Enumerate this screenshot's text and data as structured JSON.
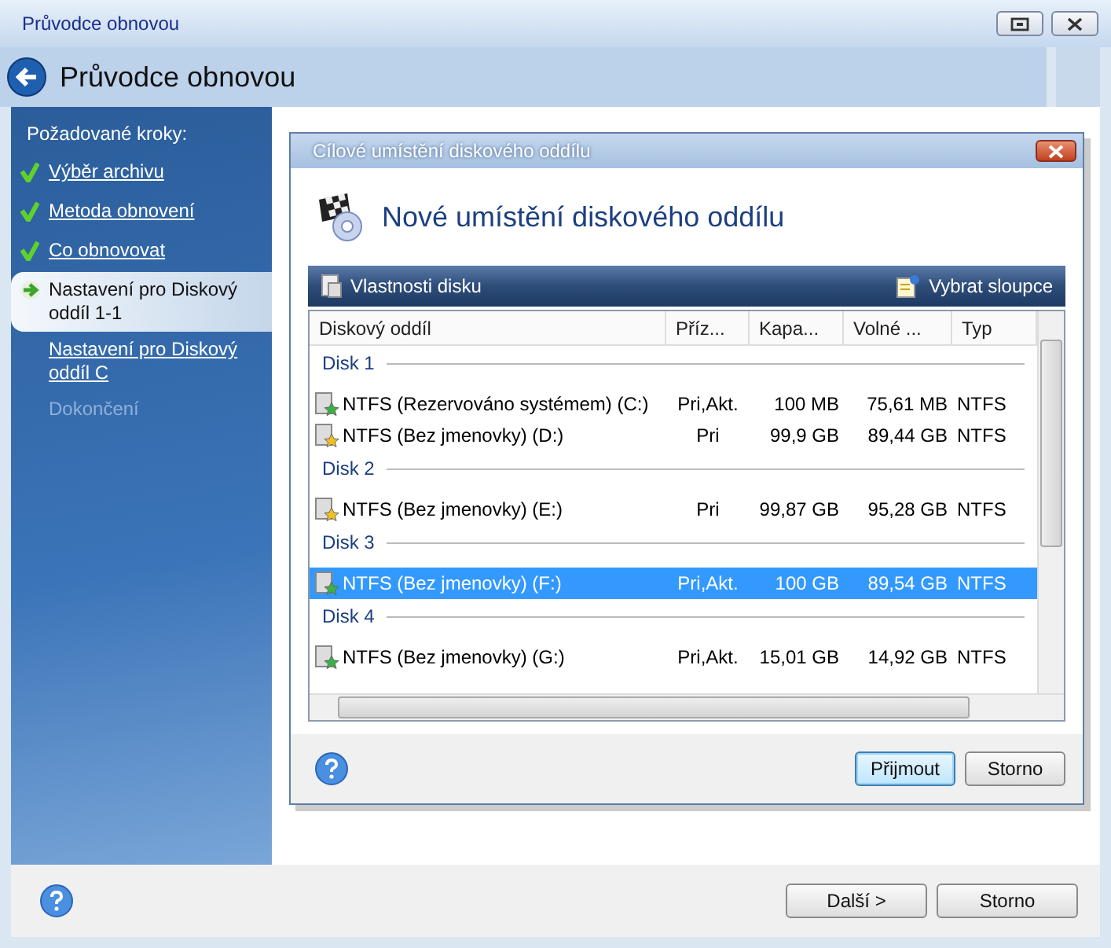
{
  "window": {
    "title": "Průvodce obnovou",
    "header": "Průvodce obnovou"
  },
  "sidebar": {
    "heading": "Požadované kroky:",
    "items": [
      {
        "label": "Výběr archivu",
        "kind": "done",
        "selected": false
      },
      {
        "label": "Metoda obnovení",
        "kind": "done",
        "selected": false
      },
      {
        "label": "Co obnovovat",
        "kind": "done",
        "selected": false
      },
      {
        "label": "Nastavení pro Diskový oddíl 1-1",
        "kind": "current",
        "selected": true
      },
      {
        "label": "Nastavení pro Diskový oddíl C",
        "kind": "link",
        "selected": false
      },
      {
        "label": "Dokončení",
        "kind": "disabled",
        "selected": false
      }
    ]
  },
  "dialog": {
    "title": "Cílové umístění diskového oddílu",
    "heading": "Nové umístění diskového oddílu",
    "toolbar": [
      "Vlastnosti disku",
      "Vybrat sloupce"
    ],
    "table": {
      "columns": [
        "Diskový oddíl",
        "Příz...",
        "Kapa...",
        "Volné ...",
        "Typ"
      ],
      "groups": [
        {
          "label": "Disk 1",
          "rows": [
            {
              "cells": [
                "NTFS (Rezervováno systémem) (C:)",
                "Pri,Akt.",
                "100 MB",
                "75,61 MB",
                "NTFS"
              ],
              "color": "#3cb043",
              "selected": false
            },
            {
              "cells": [
                "NTFS (Bez jmenovky) (D:)",
                "Pri",
                "99,9 GB",
                "89,44 GB",
                "NTFS"
              ],
              "color": "#f0c020",
              "selected": false
            }
          ]
        },
        {
          "label": "Disk 2",
          "rows": [
            {
              "cells": [
                "NTFS (Bez jmenovky) (E:)",
                "Pri",
                "99,87 GB",
                "95,28 GB",
                "NTFS"
              ],
              "color": "#f0c020",
              "selected": false
            }
          ]
        },
        {
          "label": "Disk 3",
          "rows": [
            {
              "cells": [
                "NTFS (Bez jmenovky) (F:)",
                "Pri,Akt.",
                "100 GB",
                "89,54 GB",
                "NTFS"
              ],
              "color": "#3cb043",
              "selected": true
            }
          ]
        },
        {
          "label": "Disk 4",
          "rows": [
            {
              "cells": [
                "NTFS (Bez jmenovky) (G:)",
                "Pri,Akt.",
                "15,01 GB",
                "14,92 GB",
                "NTFS"
              ],
              "color": "#3cb043",
              "selected": false
            }
          ]
        }
      ]
    },
    "buttons": [
      {
        "label": "Přijmout",
        "default": true
      },
      {
        "label": "Storno",
        "default": false
      }
    ]
  },
  "footer": {
    "buttons": [
      "Další >",
      "Storno"
    ]
  }
}
